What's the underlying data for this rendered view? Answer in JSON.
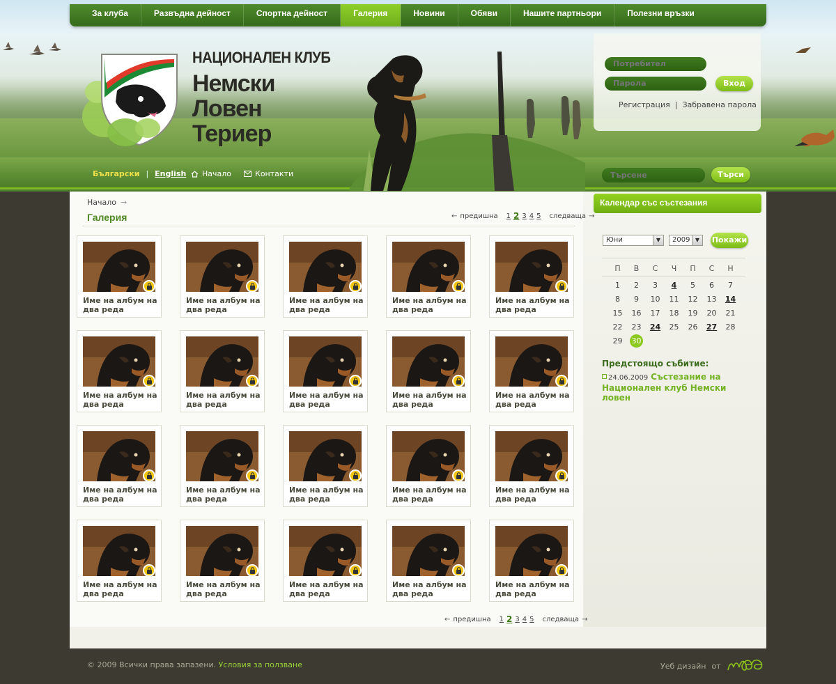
{
  "topnav": {
    "items": [
      {
        "label": "За клуба"
      },
      {
        "label": "Развъдна дейност"
      },
      {
        "label": "Спортна дейност"
      },
      {
        "label": "Галерия",
        "active": true
      },
      {
        "label": "Новини"
      },
      {
        "label": "Обяви"
      },
      {
        "label": "Нашите партньори"
      },
      {
        "label": "Полезни връзки"
      }
    ]
  },
  "logo": {
    "line1": "НАЦИОНАЛЕН КЛУБ",
    "line2": "Немски",
    "line3": "Ловен Териер"
  },
  "login": {
    "username_placeholder": "Потребител",
    "password_placeholder": "Парола",
    "submit_label": "Вход",
    "register_link": "Регистрация",
    "separator": "|",
    "forgot_link": "Забравена парола"
  },
  "lang": {
    "bg": "Български",
    "separator": "|",
    "en": "English"
  },
  "header_links": {
    "home": "Начало",
    "contacts": "Контакти"
  },
  "search": {
    "placeholder": "Търсене",
    "button_label": "Търси"
  },
  "breadcrumb": {
    "home": "Начало"
  },
  "page": {
    "title": "Галерия"
  },
  "pager": {
    "prev_label": "предишна",
    "next_label": "следваща",
    "pages": [
      "1",
      "2",
      "3",
      "4",
      "5"
    ],
    "current": "2"
  },
  "albums": [
    {
      "caption": "Име на албум на два реда"
    },
    {
      "caption": "Име на албум на два реда"
    },
    {
      "caption": "Име на албум на два реда"
    },
    {
      "caption": "Име на албум на два реда"
    },
    {
      "caption": "Име на албум на два реда"
    },
    {
      "caption": "Име на албум на два реда"
    },
    {
      "caption": "Име на албум на два реда"
    },
    {
      "caption": "Име на албум на два реда"
    },
    {
      "caption": "Име на албум на два реда"
    },
    {
      "caption": "Име на албум на два реда"
    },
    {
      "caption": "Име на албум на два реда"
    },
    {
      "caption": "Име на албум на два реда"
    },
    {
      "caption": "Име на албум на два реда"
    },
    {
      "caption": "Име на албум на два реда"
    },
    {
      "caption": "Име на албум на два реда"
    },
    {
      "caption": "Име на албум на два реда"
    },
    {
      "caption": "Име на албум на два реда"
    },
    {
      "caption": "Име на албум на два реда"
    },
    {
      "caption": "Име на албум на два реда"
    },
    {
      "caption": "Име на албум на два реда"
    }
  ],
  "calendar": {
    "title": "Календар със състезания",
    "month": "Юни",
    "year": "2009",
    "show_label": "Покажи",
    "weekdays": [
      "П",
      "В",
      "С",
      "Ч",
      "П",
      "С",
      "Н"
    ],
    "weeks": [
      [
        {
          "d": "1"
        },
        {
          "d": "2"
        },
        {
          "d": "3"
        },
        {
          "d": "4",
          "bold": true
        },
        {
          "d": "5"
        },
        {
          "d": "6"
        },
        {
          "d": "7"
        }
      ],
      [
        {
          "d": "8"
        },
        {
          "d": "9"
        },
        {
          "d": "10"
        },
        {
          "d": "11"
        },
        {
          "d": "12"
        },
        {
          "d": "13"
        },
        {
          "d": "14",
          "bold": true
        }
      ],
      [
        {
          "d": "15"
        },
        {
          "d": "16"
        },
        {
          "d": "17"
        },
        {
          "d": "18"
        },
        {
          "d": "19"
        },
        {
          "d": "20"
        },
        {
          "d": "21"
        }
      ],
      [
        {
          "d": "22"
        },
        {
          "d": "23"
        },
        {
          "d": "24",
          "bold": true
        },
        {
          "d": "25"
        },
        {
          "d": "26"
        },
        {
          "d": "27",
          "bold": true
        },
        {
          "d": "28"
        }
      ],
      [
        {
          "d": "29"
        },
        {
          "d": "30",
          "today": true
        },
        {
          "d": ""
        },
        {
          "d": ""
        },
        {
          "d": ""
        },
        {
          "d": ""
        },
        {
          "d": ""
        }
      ]
    ]
  },
  "upcoming": {
    "title": "Предстоящо събитие:",
    "date": "24.06.2009",
    "event": "Състезание на Национален клуб Немски ловен"
  },
  "footer": {
    "copyright": "© 2009 Всички права запазени.",
    "terms": "Условия за ползване",
    "credit": "Уеб дизайн",
    "credit_from": "от",
    "designer_logo_text": "MPG"
  },
  "colors": {
    "nav_bg": "#356b1a",
    "accent_green": "#7dbb1f",
    "title_green": "#4e8a22",
    "lock_yellow": "#f1c40f",
    "footer_bg": "#3d3b31"
  }
}
